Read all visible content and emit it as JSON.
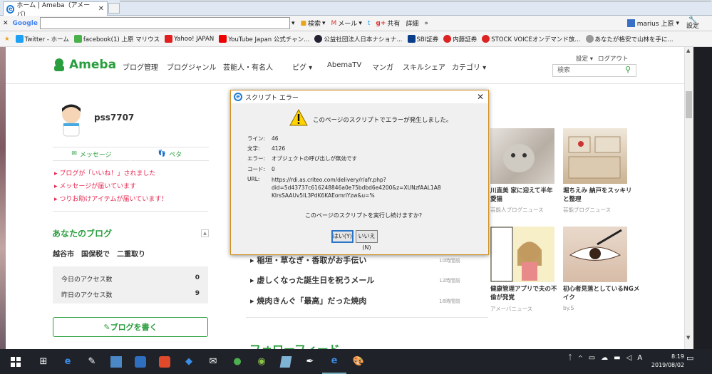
{
  "browser": {
    "tab_title": "ホーム | Ameba（アメーバ）",
    "google_label": "Google",
    "toolbar": {
      "search": "検索",
      "mail": "メール",
      "share": "共有",
      "details": "詳細",
      "more": "»"
    },
    "user": "marius 上原",
    "settings": "設定",
    "favorites": [
      "Twitter - ホーム",
      "facebook(1) 上原 マリウス",
      "Yahoo! JAPAN",
      "YouTube Japan 公式チャン...",
      "公益社団法人日本ナショナ...",
      "SBI証券",
      "内藤証券",
      "STOCK VOICEオンデマンド放...",
      "あなたが格安で山林を手に..."
    ]
  },
  "site": {
    "logo": "Ameba",
    "nav": [
      "ブログ管理",
      "ブログジャンル",
      "芸能人・有名人",
      "ピグ",
      "AbemaTV",
      "マンガ",
      "スキルシェア",
      "カテゴリ"
    ],
    "settings": "設定",
    "logout": "ログアウト",
    "search_placeholder": "検索"
  },
  "sidebar": {
    "username": "pss7707",
    "message_btn": "メッセージ",
    "peta_btn": "ペタ",
    "notices": [
      "ブログが「いいね！」されました",
      "メッセージが届いています",
      "つりお助けアイテムが届いています！"
    ],
    "your_blog": "あなたのブログ",
    "blog_name": "越谷市　国保税で　二重取り",
    "today_label": "今日のアクセス数",
    "today_value": "0",
    "yesterday_label": "昨日のアクセス数",
    "yesterday_value": "9",
    "write_btn": "ブログを書く"
  },
  "news": [
    {
      "title": "稲垣・草なぎ・香取がお手伝い",
      "time": "10時間前"
    },
    {
      "title": "虚しくなった誕生日を祝うメール",
      "time": "12時間前"
    },
    {
      "title": "焼肉きんぐ「最高」だった焼肉",
      "time": "18時間前"
    }
  ],
  "feed_title": "フォローフィード",
  "thumbs": [
    {
      "title": "川直美 家に迎えて半年\n愛猫",
      "source": "芸能人ブログニュース"
    },
    {
      "title": "堀ちえみ 納戸をスッキリ\nと整理",
      "source": "芸能ブログニュース"
    },
    {
      "title": "健康管理アプリで夫の不\n倫が発覚",
      "source": "アメーバニュース"
    },
    {
      "title": "初心者見落としているNGメ\nイク",
      "source": "by.S"
    }
  ],
  "dialog": {
    "title": "スクリプト エラー",
    "heading": "このページのスクリプトでエラーが発生しました。",
    "line_label": "ライン:",
    "line": "46",
    "char_label": "文字:",
    "char": "4126",
    "error_label": "エラー:",
    "error": "オブジェクトの呼び出しが無効です",
    "code_label": "コード:",
    "code": "0",
    "url_label": "URL:",
    "url": "https://rdi.as.criteo.com/delivery/r/afr.php?\ndid=5d43737c616248846a0e75bdbd6e4200&z=XUNzfAAL1A8\nKlrsSAAUv5IL3PdK6KAEomriYzw&u=%",
    "question": "このページのスクリプトを実行し続けますか?",
    "yes": "はい(Y)",
    "no": "いいえ(N)"
  },
  "clock": {
    "time": "8:19",
    "date": "2019/08/02"
  },
  "tray_ime": "A",
  "colors": {
    "ameba_green": "#2a9e3e",
    "notice_red": "#e62850",
    "dialog_border": "#d09020"
  }
}
